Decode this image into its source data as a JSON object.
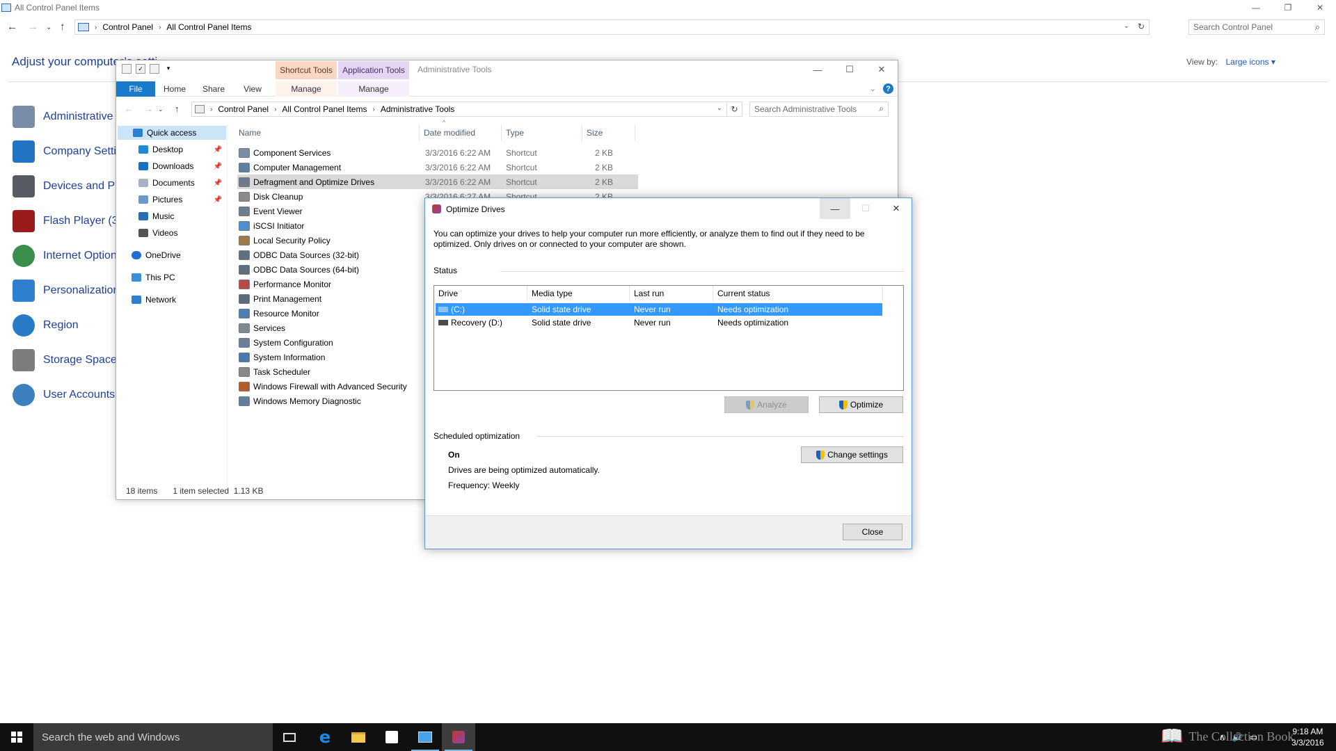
{
  "control_panel": {
    "window_title": "All Control Panel Items",
    "caption": {
      "minimize": "—",
      "restore": "❐",
      "close": "✕"
    },
    "breadcrumb": [
      "Control Panel",
      "All Control Panel Items"
    ],
    "search_placeholder": "Search Control Panel",
    "heading": "Adjust your computer’s setti",
    "view_by_label": "View by:",
    "view_by_value": "Large icons ▾",
    "items": [
      {
        "label": "Administrative",
        "color": "#7a8da6"
      },
      {
        "label": "Company Setti",
        "color": "#2273c2"
      },
      {
        "label": "Devices and Pri",
        "color": "#555a63"
      },
      {
        "label": "Flash Player (32",
        "color": "#9b1b1b"
      },
      {
        "label": "Internet Option",
        "color": "#3a8f4c"
      },
      {
        "label": "Personalization",
        "color": "#2f7fd0"
      },
      {
        "label": "Region",
        "color": "#2a7bc7"
      },
      {
        "label": "Storage Spaces",
        "color": "#7d7d7d"
      },
      {
        "label": "User Accounts",
        "color": "#3d7fbf"
      }
    ]
  },
  "explorer": {
    "title": "Administrative Tools",
    "context_headers": {
      "shortcut_tools": "Shortcut Tools",
      "application_tools": "Application Tools"
    },
    "ribbon_tabs": {
      "file": "File",
      "home": "Home",
      "share": "Share",
      "view": "View",
      "manage1": "Manage",
      "manage2": "Manage"
    },
    "help": "?",
    "breadcrumb": [
      "Control Panel",
      "All Control Panel Items",
      "Administrative Tools"
    ],
    "search_placeholder": "Search Administrative Tools",
    "nav": {
      "quick_access": "Quick access",
      "desktop": "Desktop",
      "downloads": "Downloads",
      "documents": "Documents",
      "pictures": "Pictures",
      "music": "Music",
      "videos": "Videos",
      "onedrive": "OneDrive",
      "this_pc": "This PC",
      "network": "Network"
    },
    "columns": {
      "name": "Name",
      "date": "Date modified",
      "type": "Type",
      "size": "Size"
    },
    "files": [
      {
        "name": "Component Services",
        "date": "3/3/2016 6:22 AM",
        "type": "Shortcut",
        "size": "2 KB"
      },
      {
        "name": "Computer Management",
        "date": "3/3/2016 6:22 AM",
        "type": "Shortcut",
        "size": "2 KB"
      },
      {
        "name": "Defragment and Optimize Drives",
        "date": "3/3/2016 6:22 AM",
        "type": "Shortcut",
        "size": "2 KB"
      },
      {
        "name": "Disk Cleanup",
        "date": "3/3/2016 6:27 AM",
        "type": "Shortcut",
        "size": "2 KB"
      },
      {
        "name": "Event Viewer",
        "date": "3",
        "type": "",
        "size": ""
      },
      {
        "name": "iSCSI Initiator",
        "date": "3",
        "type": "",
        "size": ""
      },
      {
        "name": "Local Security Policy",
        "date": "3",
        "type": "",
        "size": ""
      },
      {
        "name": "ODBC Data Sources (32-bit)",
        "date": "3",
        "type": "",
        "size": ""
      },
      {
        "name": "ODBC Data Sources (64-bit)",
        "date": "3",
        "type": "",
        "size": ""
      },
      {
        "name": "Performance Monitor",
        "date": "3",
        "type": "",
        "size": ""
      },
      {
        "name": "Print Management",
        "date": "3",
        "type": "",
        "size": ""
      },
      {
        "name": "Resource Monitor",
        "date": "3",
        "type": "",
        "size": ""
      },
      {
        "name": "Services",
        "date": "3",
        "type": "",
        "size": ""
      },
      {
        "name": "System Configuration",
        "date": "3",
        "type": "",
        "size": ""
      },
      {
        "name": "System Information",
        "date": "3",
        "type": "",
        "size": ""
      },
      {
        "name": "Task Scheduler",
        "date": "3",
        "type": "",
        "size": ""
      },
      {
        "name": "Windows Firewall with Advanced Security",
        "date": "3",
        "type": "",
        "size": ""
      },
      {
        "name": "Windows Memory Diagnostic",
        "date": "3",
        "type": "",
        "size": ""
      }
    ],
    "status": {
      "count": "18 items",
      "selected": "1 item selected",
      "size": "1.13 KB"
    }
  },
  "dialog": {
    "title": "Optimize Drives",
    "caption": {
      "minimize": "—",
      "maximize": "☐",
      "close": "✕"
    },
    "description": "You can optimize your drives to help your computer run more efficiently, or analyze them to find out if they need to be optimized. Only drives on or connected to your computer are shown.",
    "status_title": "Status",
    "columns": {
      "drive": "Drive",
      "media": "Media type",
      "last_run": "Last run",
      "status": "Current status"
    },
    "drives": [
      {
        "drive": "(C:)",
        "media": "Solid state drive",
        "last_run": "Never run",
        "status": "Needs optimization"
      },
      {
        "drive": "Recovery (D:)",
        "media": "Solid state drive",
        "last_run": "Never run",
        "status": "Needs optimization"
      }
    ],
    "analyze_label": "Analyze",
    "optimize_label": "Optimize",
    "scheduled_title": "Scheduled optimization",
    "scheduled_state": "On",
    "scheduled_desc": "Drives are being optimized automatically.",
    "frequency": "Frequency: Weekly",
    "change_settings_label": "Change settings",
    "close_label": "Close"
  },
  "taskbar": {
    "search_placeholder": "Search the web and Windows",
    "watermark": "The Collection Book",
    "clock_time": "9:18 AM",
    "clock_date": "3/3/2016"
  }
}
